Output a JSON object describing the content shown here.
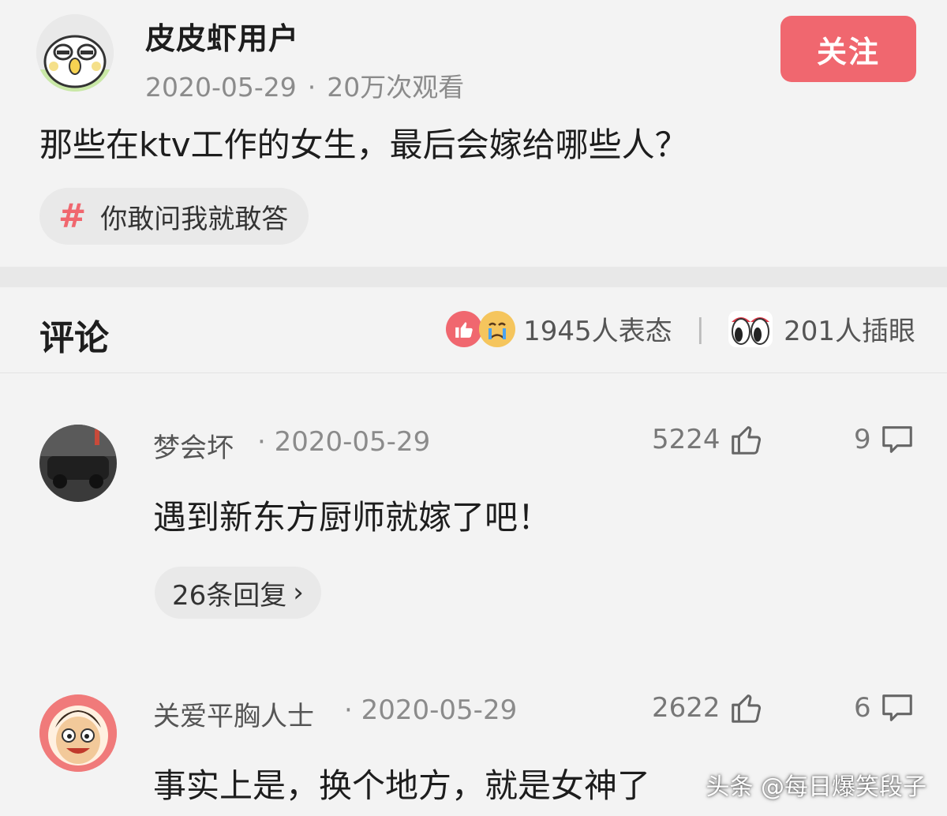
{
  "post": {
    "username": "皮皮虾用户",
    "date": "2020-05-29",
    "dot": "·",
    "views": "20万次观看",
    "follow_label": "关注",
    "question": "那些在ktv工作的女生，最后会嫁给哪些人？",
    "topic": {
      "hash": "#",
      "label": "你敢问我就敢答"
    }
  },
  "comments_section": {
    "title": "评论",
    "reactions_count": "1945人表态",
    "separator": "|",
    "insert_eyes_count": "201人插眼"
  },
  "comments": [
    {
      "name": "梦会坏",
      "dot": "·",
      "date": "2020-05-29",
      "likes": "5224",
      "replies": "9",
      "text": "遇到新东方厨师就嫁了吧！",
      "reply_link": "26条回复",
      "reply_chevron": "›"
    },
    {
      "name": "关爱平胸人士",
      "dot": "·",
      "date": "2020-05-29",
      "likes": "2622",
      "replies": "6",
      "text": "事实上是，换个地方，就是女神了"
    }
  ],
  "watermark": "头条 @每日爆笑段子",
  "colors": {
    "accent": "#f0676f",
    "background": "#f3f3f3",
    "muted_text": "#8b8b8b"
  }
}
